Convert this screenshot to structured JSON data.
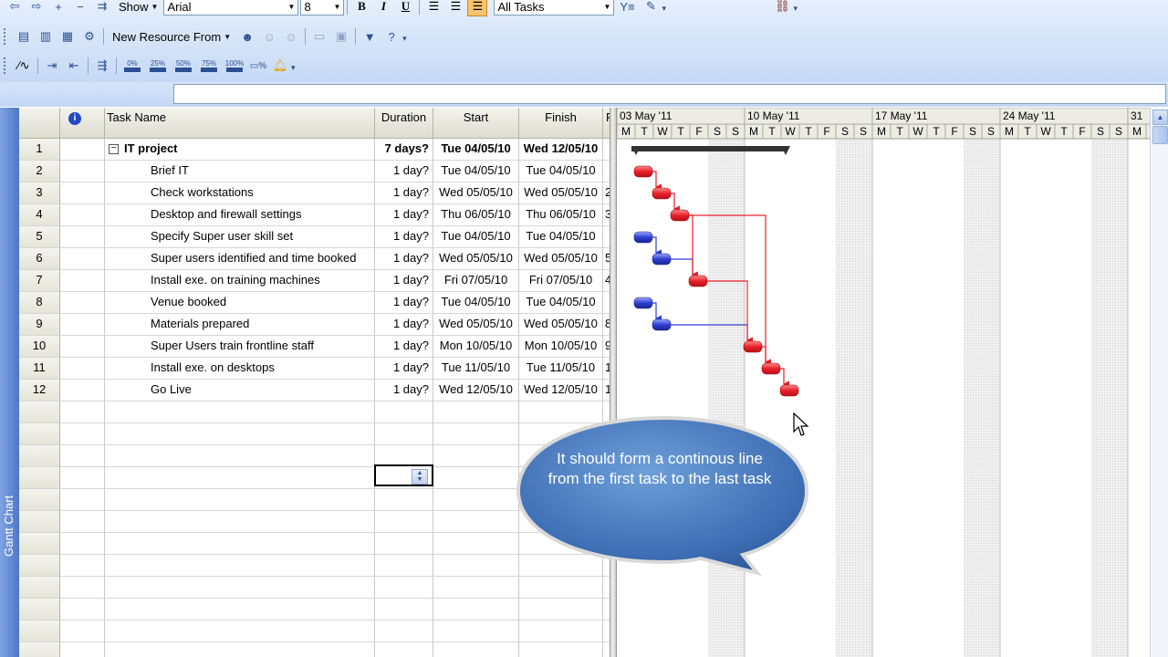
{
  "toolbar1": {
    "show_label": "Show",
    "font": "Arial",
    "font_size": "8",
    "filter": "All Tasks",
    "bold_icon": "B",
    "italic_icon": "I",
    "underline_icon": "U"
  },
  "toolbar2": {
    "new_resource_label": "New Resource From"
  },
  "toolbar3": {
    "pct": [
      "0%",
      "25%",
      "50%",
      "75%",
      "100%"
    ]
  },
  "side_label": "Gantt Chart",
  "table": {
    "headers": {
      "task_name": "Task Name",
      "duration": "Duration",
      "start": "Start",
      "finish": "Finish",
      "pred": "P"
    },
    "rows": [
      {
        "id": "1",
        "name": "IT project",
        "duration": "7 days?",
        "start": "Tue 04/05/10",
        "finish": "Wed 12/05/10",
        "extra": ""
      },
      {
        "id": "2",
        "name": "Brief IT",
        "duration": "1 day?",
        "start": "Tue 04/05/10",
        "finish": "Tue 04/05/10",
        "extra": ""
      },
      {
        "id": "3",
        "name": "Check workstations",
        "duration": "1 day?",
        "start": "Wed 05/05/10",
        "finish": "Wed 05/05/10",
        "extra": "2"
      },
      {
        "id": "4",
        "name": "Desktop and firewall settings",
        "duration": "1 day?",
        "start": "Thu 06/05/10",
        "finish": "Thu 06/05/10",
        "extra": "3"
      },
      {
        "id": "5",
        "name": "Specify Super user skill set",
        "duration": "1 day?",
        "start": "Tue 04/05/10",
        "finish": "Tue 04/05/10",
        "extra": ""
      },
      {
        "id": "6",
        "name": "Super users identified and time booked",
        "duration": "1 day?",
        "start": "Wed 05/05/10",
        "finish": "Wed 05/05/10",
        "extra": "5"
      },
      {
        "id": "7",
        "name": "Install exe. on training machines",
        "duration": "1 day?",
        "start": "Fri 07/05/10",
        "finish": "Fri 07/05/10",
        "extra": "4"
      },
      {
        "id": "8",
        "name": "Venue booked",
        "duration": "1 day?",
        "start": "Tue 04/05/10",
        "finish": "Tue 04/05/10",
        "extra": ""
      },
      {
        "id": "9",
        "name": "Materials prepared",
        "duration": "1 day?",
        "start": "Wed 05/05/10",
        "finish": "Wed 05/05/10",
        "extra": "8"
      },
      {
        "id": "10",
        "name": "Super Users train frontline staff",
        "duration": "1 day?",
        "start": "Mon 10/05/10",
        "finish": "Mon 10/05/10",
        "extra": "9"
      },
      {
        "id": "11",
        "name": "Install exe. on desktops",
        "duration": "1 day?",
        "start": "Tue 11/05/10",
        "finish": "Tue 11/05/10",
        "extra": "1"
      },
      {
        "id": "12",
        "name": "Go Live",
        "duration": "1 day?",
        "start": "Wed 12/05/10",
        "finish": "Wed 12/05/10",
        "extra": "1"
      }
    ]
  },
  "gantt": {
    "weeks": [
      "03 May '11",
      "10 May '11",
      "17 May '11",
      "24 May '11",
      "31"
    ],
    "days": [
      "M",
      "T",
      "W",
      "T",
      "F",
      "S",
      "S"
    ],
    "colors": {
      "critical": "#e8202a",
      "normal": "#2e3fd0",
      "summary": "#333333",
      "weekend": "#e6e6e6"
    }
  },
  "callout": "It should form a continous line from the first task to the last task"
}
